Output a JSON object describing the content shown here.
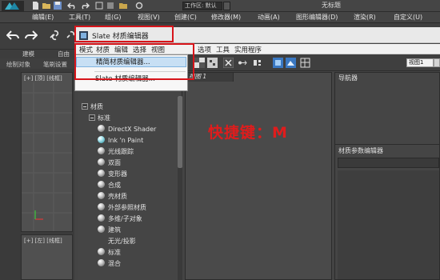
{
  "host": {
    "window_title": "无标题",
    "workspace_label": "工作区: 默认",
    "menus": [
      "编辑(E)",
      "工具(T)",
      "组(G)",
      "视图(V)",
      "创建(C)",
      "修改器(M)",
      "动画(A)",
      "图形编辑器(D)",
      "渲染(R)",
      "自定义(U)"
    ],
    "ribbon": [
      "建模",
      "自由"
    ],
    "subribbon": [
      "绘制对象",
      "笔刷设置"
    ],
    "viewport_top_label": "[+] [顶] [线框]",
    "viewport_bottom_label": "[+] [左] [线框]"
  },
  "slate": {
    "title": "Slate 材质编辑器",
    "menus": [
      "模式",
      "材质",
      "编辑",
      "选择",
      "视图",
      "选项",
      "工具",
      "实用程序"
    ],
    "view_select": "视图1",
    "view_tab": "视图 1",
    "navigator_title": "导航器",
    "param_title": "材质参数编辑器",
    "shortcut_text": "快捷键：M",
    "mode_menu": {
      "item_compact": "精简材质编辑器...",
      "item_slate": "Slate 材质编辑器..."
    },
    "browser": {
      "group_materials": "材质",
      "group_standard": "标准",
      "materials": [
        {
          "label": "DirectX Shader",
          "icon": "sphere-icon"
        },
        {
          "label": "Ink 'n Paint",
          "icon": "teal-sphere-icon"
        },
        {
          "label": "光线跟踪",
          "icon": "sphere-icon"
        },
        {
          "label": "双面",
          "icon": "sphere-icon"
        },
        {
          "label": "变形器",
          "icon": "sphere-icon"
        },
        {
          "label": "合成",
          "icon": "sphere-icon"
        },
        {
          "label": "壳材质",
          "icon": "sphere-icon"
        },
        {
          "label": "外部参照材质",
          "icon": "sphere-icon"
        },
        {
          "label": "多维/子对象",
          "icon": "sphere-icon"
        },
        {
          "label": "建筑",
          "icon": "sphere-icon"
        },
        {
          "label": "无光/投影",
          "icon": "none"
        },
        {
          "label": "标准",
          "icon": "sphere-icon"
        },
        {
          "label": "混合",
          "icon": "sphere-icon"
        }
      ]
    }
  },
  "colors": {
    "highlight_red": "#d7141a",
    "shortcut_red": "#e01c1c",
    "menu_selected": "#c7dff4"
  }
}
